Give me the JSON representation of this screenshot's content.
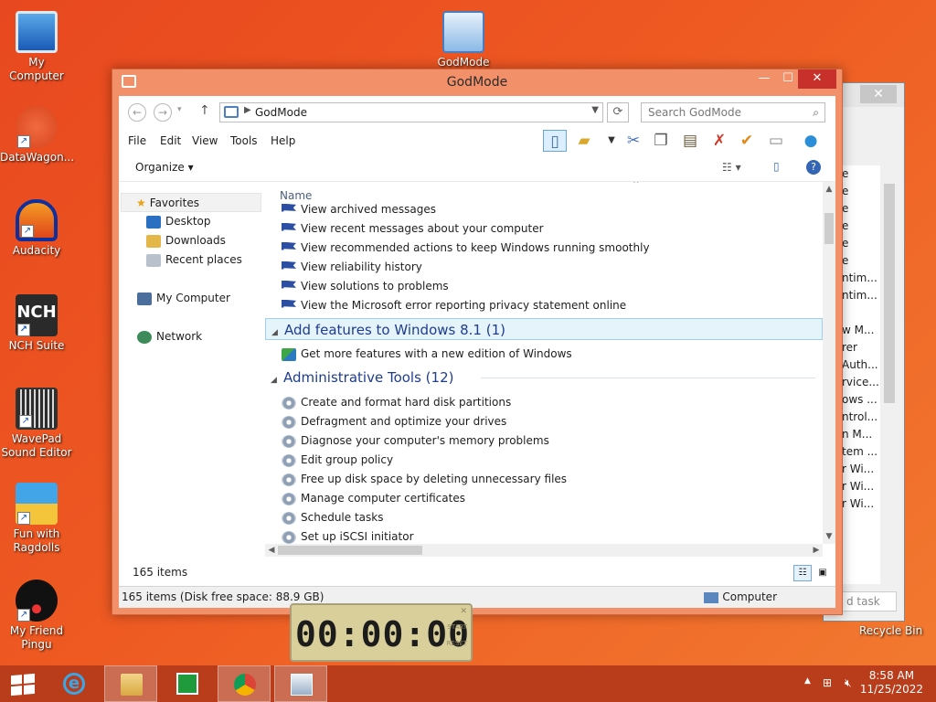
{
  "desktop": {
    "icons": [
      {
        "label": "My Computer"
      },
      {
        "label": "DataWagon..."
      },
      {
        "label": "Audacity"
      },
      {
        "label": "NCH Suite"
      },
      {
        "label": "WavePad Sound Editor"
      },
      {
        "label": "Fun with Ragdolls"
      },
      {
        "label": "My Friend Pingu"
      },
      {
        "label": "GodMode"
      }
    ],
    "recycle_bin": "Recycle Bin",
    "nch_logo": "NCH"
  },
  "background_window": {
    "rows": [
      "e",
      "e",
      "e",
      "e",
      "e",
      "e",
      "ntim...",
      "ntim...",
      "",
      "w M...",
      "rer",
      "Auth...",
      "rvice...",
      "ows ...",
      "ntrol...",
      "n M...",
      "tem ...",
      "r Wi...",
      "r Wi...",
      "r Wi..."
    ],
    "footer": "d task"
  },
  "window": {
    "title": "GodMode",
    "address": {
      "location": "GodMode",
      "search_placeholder": "Search GodMode"
    },
    "menu": [
      "File",
      "Edit",
      "View",
      "Tools",
      "Help"
    ],
    "command_bar": {
      "organize": "Organize"
    },
    "nav_pane": {
      "favorites": "Favorites",
      "desktop": "Desktop",
      "downloads": "Downloads",
      "recent_places": "Recent places",
      "my_computer": "My Computer",
      "network": "Network"
    },
    "column_header": "Name",
    "items_top": [
      "View archived messages",
      "View recent messages about your computer",
      "View recommended actions to keep Windows running smoothly",
      "View reliability history",
      "View solutions to problems",
      "View the Microsoft error reporting privacy statement online"
    ],
    "group_add_features": "Add features to Windows 8.1 (1)",
    "items_add_features": [
      "Get more features with a new edition of Windows"
    ],
    "group_admin_tools": "Administrative Tools (12)",
    "items_admin_tools": [
      "Create and format hard disk partitions",
      "Defragment and optimize your drives",
      "Diagnose your computer's memory problems",
      "Edit group policy",
      "Free up disk space by deleting unnecessary files",
      "Manage computer certificates",
      "Schedule tasks",
      "Set up iSCSI initiator"
    ],
    "status_items": "165 items",
    "status_bar": "165 items (Disk free space: 88.9 GB)",
    "status_location": "Computer"
  },
  "timer": {
    "display": "00:00:00",
    "start": "START",
    "reset": "RESET"
  },
  "taskbar": {
    "time": "8:58 AM",
    "date": "11/25/2022"
  }
}
